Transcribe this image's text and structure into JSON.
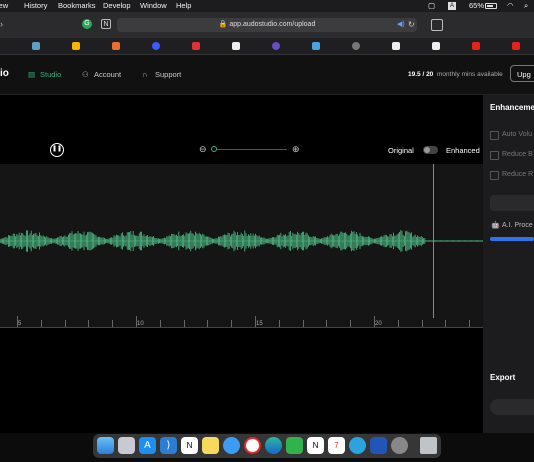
{
  "menubar": {
    "items": [
      "View",
      "History",
      "Bookmarks",
      "Develop",
      "Window",
      "Help"
    ],
    "battery": "65%"
  },
  "browser": {
    "url": "app.audostudio.com/upload"
  },
  "app": {
    "logo_fragment": "io",
    "nav": [
      "Studio",
      "Account",
      "Support"
    ],
    "mins_value": "19.5 / 20",
    "mins_label": "monthly mins available",
    "upgrade_label": "Upg"
  },
  "player": {
    "toggle_original": "Original",
    "toggle_enhanced": "Enhanced",
    "timeline_labels": [
      "5",
      "10",
      "15",
      "20"
    ]
  },
  "sidebar": {
    "title": "Enhanceme",
    "options": [
      "Auto Volu",
      "Reduce B",
      "Reduce R"
    ],
    "ai_process": "A.I. Proce",
    "export_title": "Export"
  },
  "colors": {
    "accent": "#3db37a",
    "waveform": "#4fbf88"
  }
}
